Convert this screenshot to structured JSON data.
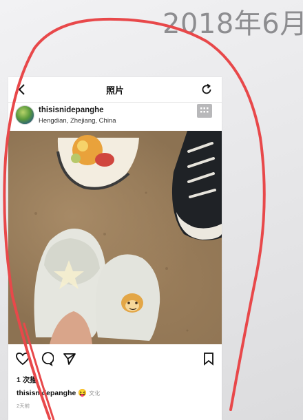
{
  "background": {
    "date_text": "2018年6月"
  },
  "nav": {
    "title": "照片",
    "back_icon": "chevron-left-icon",
    "refresh_icon": "refresh-icon"
  },
  "post": {
    "username": "thisisnidepanghe",
    "location": "Hengdian, Zhejiang, China",
    "more_icon": "more-grid-icon"
  },
  "actions": {
    "like_icon": "heart-icon",
    "comment_icon": "comment-icon",
    "share_icon": "send-icon",
    "save_icon": "bookmark-icon"
  },
  "stats": {
    "views": "1 次播"
  },
  "caption": {
    "username": "thisisnidepanghe",
    "emoji": "😝",
    "tag": "文化"
  },
  "time_ago": "2天前",
  "colors": {
    "annotation_red": "#e8484a",
    "date_gray": "#8d8d90"
  }
}
